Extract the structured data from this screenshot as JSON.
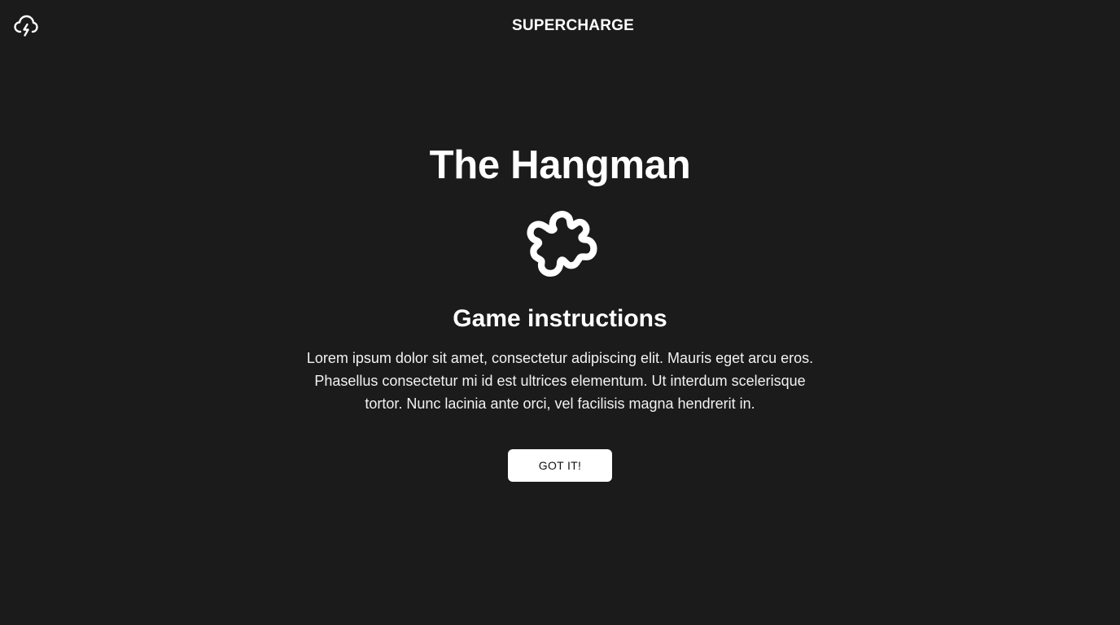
{
  "header": {
    "brand": "SUPERCHARGE",
    "logo_icon": "cloud-lightning-icon"
  },
  "main": {
    "title": "The Hangman",
    "icon": "puzzle-piece-icon",
    "subtitle": "Game instructions",
    "instructions": "Lorem ipsum dolor sit amet, consectetur adipiscing elit. Mauris eget arcu eros. Phasellus consectetur mi id est ultrices elementum. Ut interdum scelerisque tortor. Nunc lacinia ante orci, vel facilisis magna hendrerit in.",
    "button_label": "GOT IT!"
  },
  "colors": {
    "background": "#1b1b1b",
    "text": "#ffffff",
    "button_background": "#ffffff",
    "button_text": "#111111"
  }
}
